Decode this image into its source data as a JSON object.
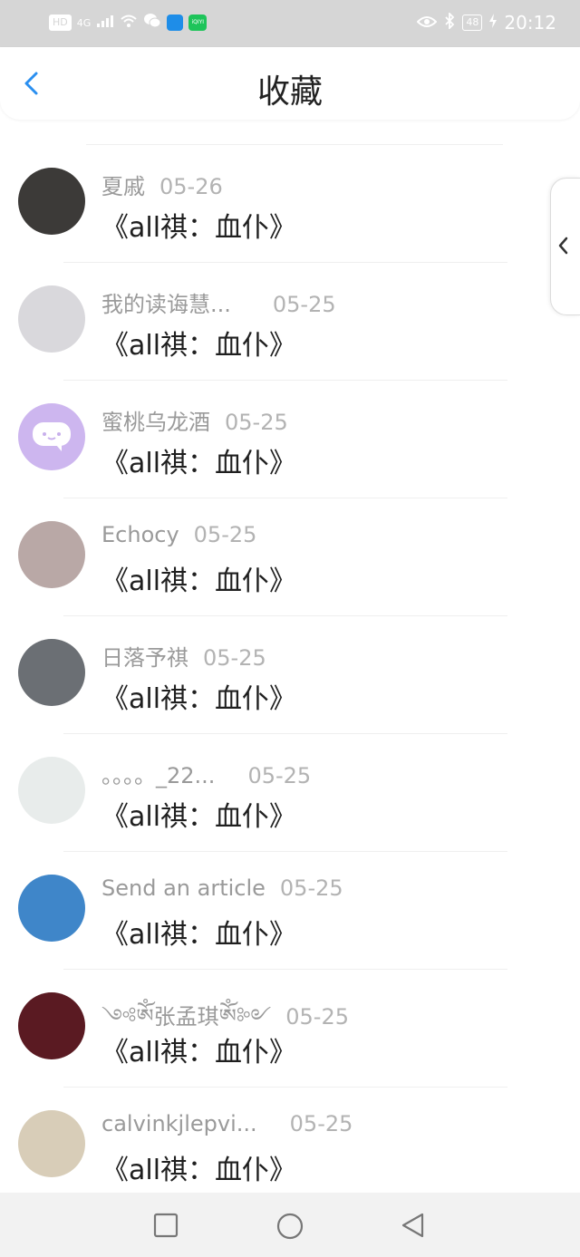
{
  "status_bar": {
    "hd": "HD",
    "network": "4G",
    "app_icon_label": "iQIYI",
    "battery": "48",
    "time": "20:12"
  },
  "header": {
    "title": "收藏",
    "back_icon": "chevron-left-icon"
  },
  "items": [
    {
      "user": "夏戚",
      "date": "05-26",
      "book": "《all祺：血仆》",
      "avatar_color": "#3c3a38"
    },
    {
      "user": "我的读诲慧...",
      "date": "05-25",
      "book": "《all祺：血仆》",
      "avatar_color": "#d9d8dc"
    },
    {
      "user": "蜜桃乌龙酒",
      "date": "05-25",
      "book": "《all祺：血仆》",
      "avatar_color": "#cdb6ef"
    },
    {
      "user": "Echocy",
      "date": "05-25",
      "book": "《all祺：血仆》",
      "avatar_color": "#b9a8a6"
    },
    {
      "user": "日落予祺",
      "date": "05-25",
      "book": "《all祺：血仆》",
      "avatar_color": "#6b6f74"
    },
    {
      "user": "。。。。_22...",
      "date": "05-25",
      "book": "《all祺：血仆》",
      "avatar_color": "#e8eceb"
    },
    {
      "user": "Send an article",
      "date": "05-25",
      "book": "《all祺：血仆》",
      "avatar_color": "#3f86c9"
    },
    {
      "user": "༺ༀ张孟琪ༀ༻",
      "date": "05-25",
      "book": "《all祺：血仆》",
      "avatar_color": "#5a1a22"
    },
    {
      "user": "calvinkjlepvi...",
      "date": "05-25",
      "book": "《all祺：血仆》",
      "avatar_color": "#d8cdb8"
    }
  ],
  "side_handle_icon": "chevron-left-icon",
  "nav": {
    "recent_icon": "square-icon",
    "home_icon": "circle-icon",
    "back_icon": "triangle-back-icon"
  },
  "colors": {
    "accent": "#2a8ff0",
    "status_bar_bg": "#d6d6d6",
    "nav_bar_bg": "#f2f2f2"
  }
}
